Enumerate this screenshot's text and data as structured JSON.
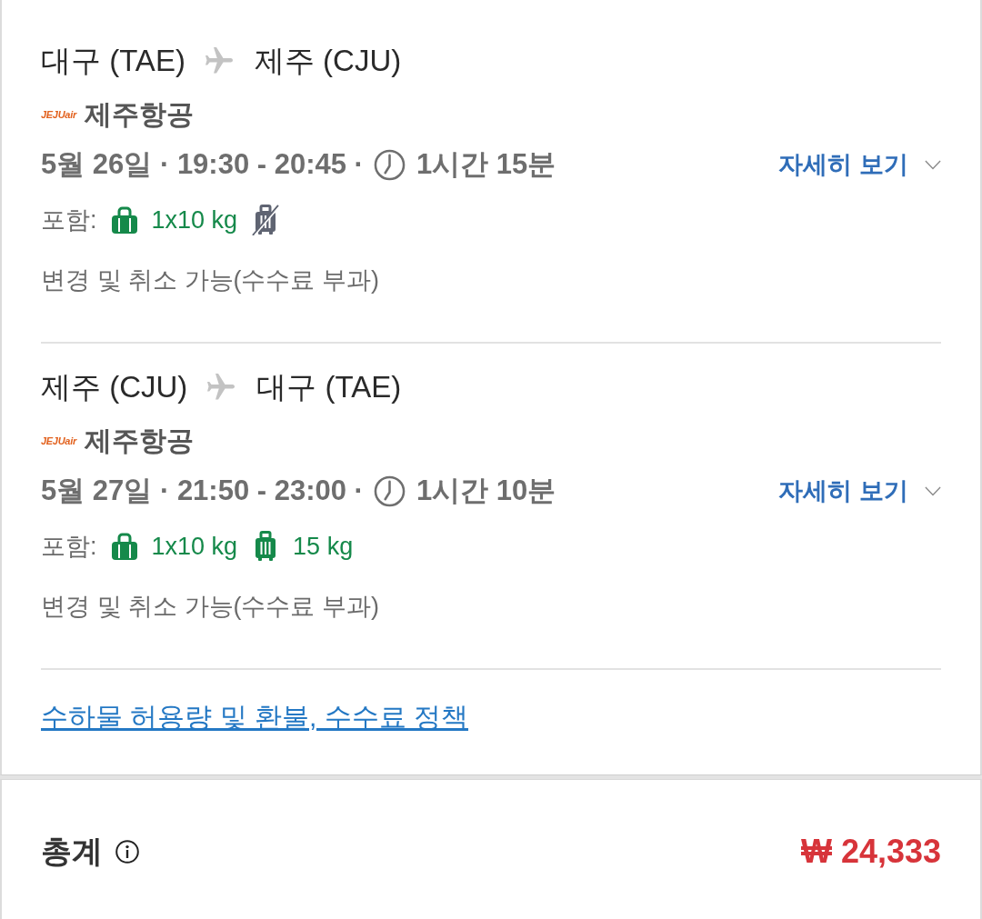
{
  "flights": [
    {
      "origin": "대구 (TAE)",
      "destination": "제주 (CJU)",
      "airline_logo": "JEJUair",
      "airline": "제주항공",
      "schedule": "5월 26일 · 19:30 - 20:45 ·",
      "duration": "1시간 15분",
      "details": {
        "label": "자세히 보기",
        "expanded": false
      },
      "included_label": "포함:",
      "baggage": [
        {
          "kind": "carry_on",
          "included": true,
          "text": "1x10 kg"
        },
        {
          "kind": "checked",
          "included": false
        }
      ],
      "policy": "변경 및 취소 가능(수수료 부과)"
    },
    {
      "origin": "제주 (CJU)",
      "destination": "대구 (TAE)",
      "airline_logo": "JEJUair",
      "airline": "제주항공",
      "schedule": "5월 27일 · 21:50 - 23:00 ·",
      "duration": "1시간 10분",
      "details": {
        "label": "자세히 보기",
        "expanded": false
      },
      "included_label": "포함:",
      "baggage": [
        {
          "kind": "carry_on",
          "included": true,
          "text": "1x10 kg"
        },
        {
          "kind": "checked",
          "included": true,
          "text": "15 kg"
        }
      ],
      "policy": "변경 및 취소 가능(수수료 부과)"
    }
  ],
  "policy_link": "수하물 허용량 및 환불, 수수료 정책",
  "total": {
    "label": "총계",
    "price": "₩ 24,333"
  }
}
